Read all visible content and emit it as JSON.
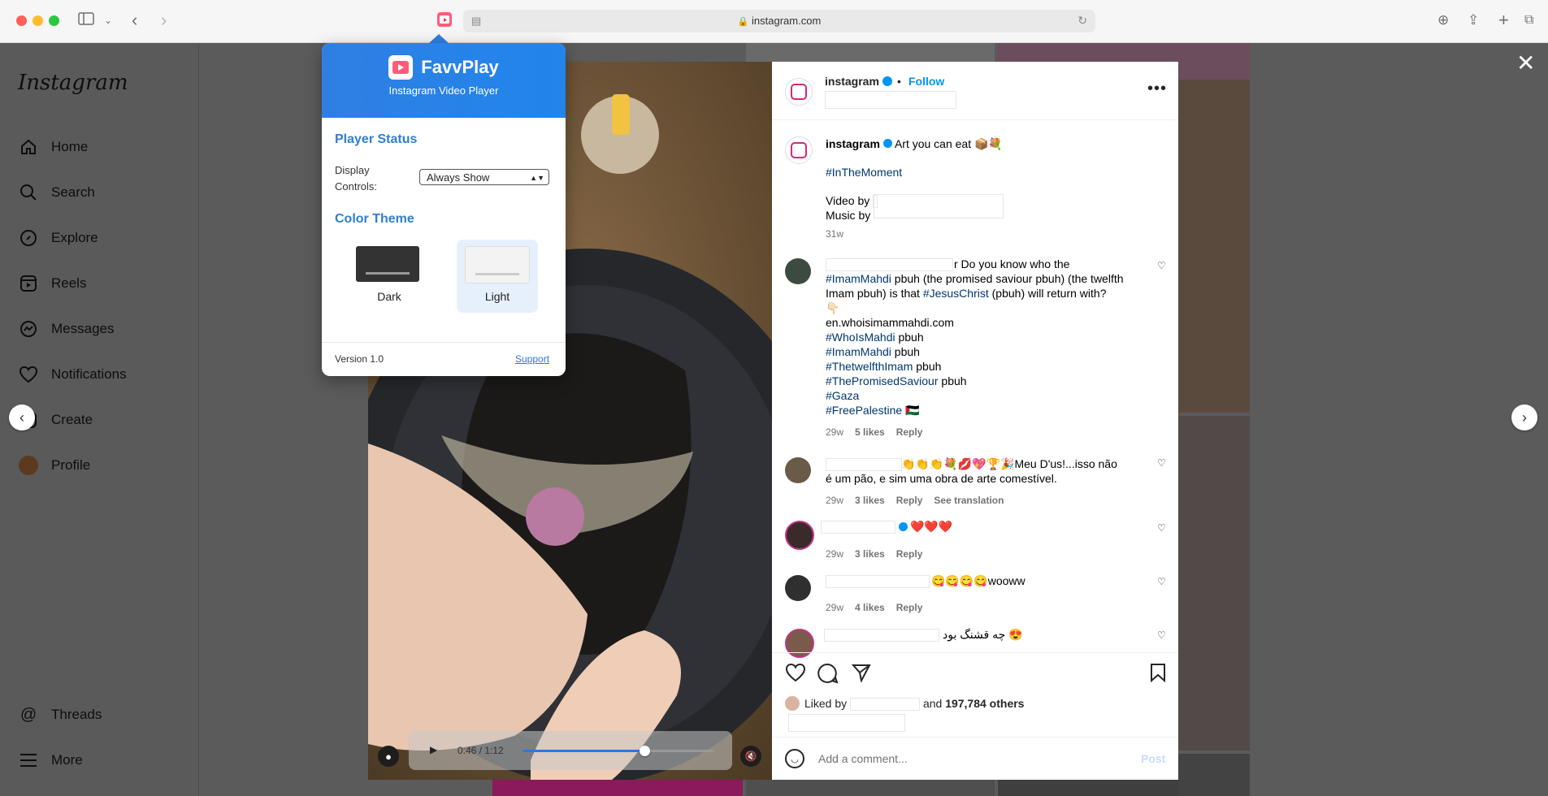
{
  "browser": {
    "url": "instagram.com"
  },
  "sidebar": {
    "logo": "Instagram",
    "items": [
      {
        "label": "Home",
        "icon": "home-icon"
      },
      {
        "label": "Search",
        "icon": "search-icon"
      },
      {
        "label": "Explore",
        "icon": "compass-icon"
      },
      {
        "label": "Reels",
        "icon": "reels-icon"
      },
      {
        "label": "Messages",
        "icon": "messenger-icon"
      },
      {
        "label": "Notifications",
        "icon": "heart-icon"
      },
      {
        "label": "Create",
        "icon": "plus-icon"
      },
      {
        "label": "Profile",
        "icon": "avatar"
      }
    ],
    "bottom": [
      {
        "label": "Threads",
        "icon": "threads-icon"
      },
      {
        "label": "More",
        "icon": "menu-icon"
      }
    ]
  },
  "popup": {
    "title": "FavvPlay",
    "subtitle": "Instagram Video Player",
    "status_title": "Player Status",
    "display_label_1": "Display",
    "display_label_2": "Controls:",
    "display_value": "Always Show",
    "theme_title": "Color Theme",
    "theme_dark": "Dark",
    "theme_light": "Light",
    "selected_theme": "Light",
    "version": "Version 1.0",
    "support": "Support"
  },
  "video": {
    "time": "0:46 / 1:12",
    "progress": 0.64
  },
  "post": {
    "username": "instagram",
    "dot": "•",
    "follow": "Follow",
    "caption": "Art you can eat 📦💐",
    "hashtag": "#InTheMoment",
    "video_by": "Video by",
    "music_by": "Music by",
    "age": "31w",
    "comments": [
      {
        "lines": [
          [
            {
              "t": "r Do you know who the"
            }
          ],
          [
            {
              "t": "#ImamMahdi",
              "tag": true
            },
            {
              "t": " pbuh (the promised saviour pbuh) (the twelfth"
            }
          ],
          [
            {
              "t": "Imam pbuh) is that "
            },
            {
              "t": "#JesusChrist",
              "tag": true
            },
            {
              "t": " (pbuh) will return with?"
            }
          ],
          [
            {
              "t": "👇🏻"
            }
          ],
          [
            {
              "t": "en.whoisimammahdi.com"
            }
          ],
          [
            {
              "t": "#WhoIsMahdi",
              "tag": true
            },
            {
              "t": " pbuh"
            }
          ],
          [
            {
              "t": "#ImamMahdi",
              "tag": true
            },
            {
              "t": " pbuh"
            }
          ],
          [
            {
              "t": "#ThetwelfthImam",
              "tag": true
            },
            {
              "t": " pbuh"
            }
          ],
          [
            {
              "t": "#ThePromisedSaviour",
              "tag": true
            },
            {
              "t": " pbuh"
            }
          ],
          [
            {
              "t": "#Gaza",
              "tag": true
            }
          ],
          [
            {
              "t": "#FreePalestine",
              "tag": true
            },
            {
              "t": " 🇵🇸"
            }
          ]
        ],
        "time": "29w",
        "likes": "5 likes",
        "reply": "Reply"
      },
      {
        "line1": "👏👏👏💐💋💖🏆🎉Meu D'us!...isso não",
        "line2": "é um pão, e sim uma obra de arte comestível.",
        "time": "29w",
        "likes": "3 likes",
        "reply": "Reply",
        "translate": "See translation"
      },
      {
        "text": "❤️❤️❤️",
        "time": "29w",
        "likes": "3 likes",
        "reply": "Reply"
      },
      {
        "text": "😋😋😋😋wooww",
        "time": "29w",
        "likes": "4 likes",
        "reply": "Reply"
      },
      {
        "text": "چه قشنگ بود 😍"
      }
    ],
    "liked_by": "Liked by",
    "and": "and",
    "others": "197,784 others",
    "comment_placeholder": "Add a comment...",
    "post_button": "Post"
  }
}
